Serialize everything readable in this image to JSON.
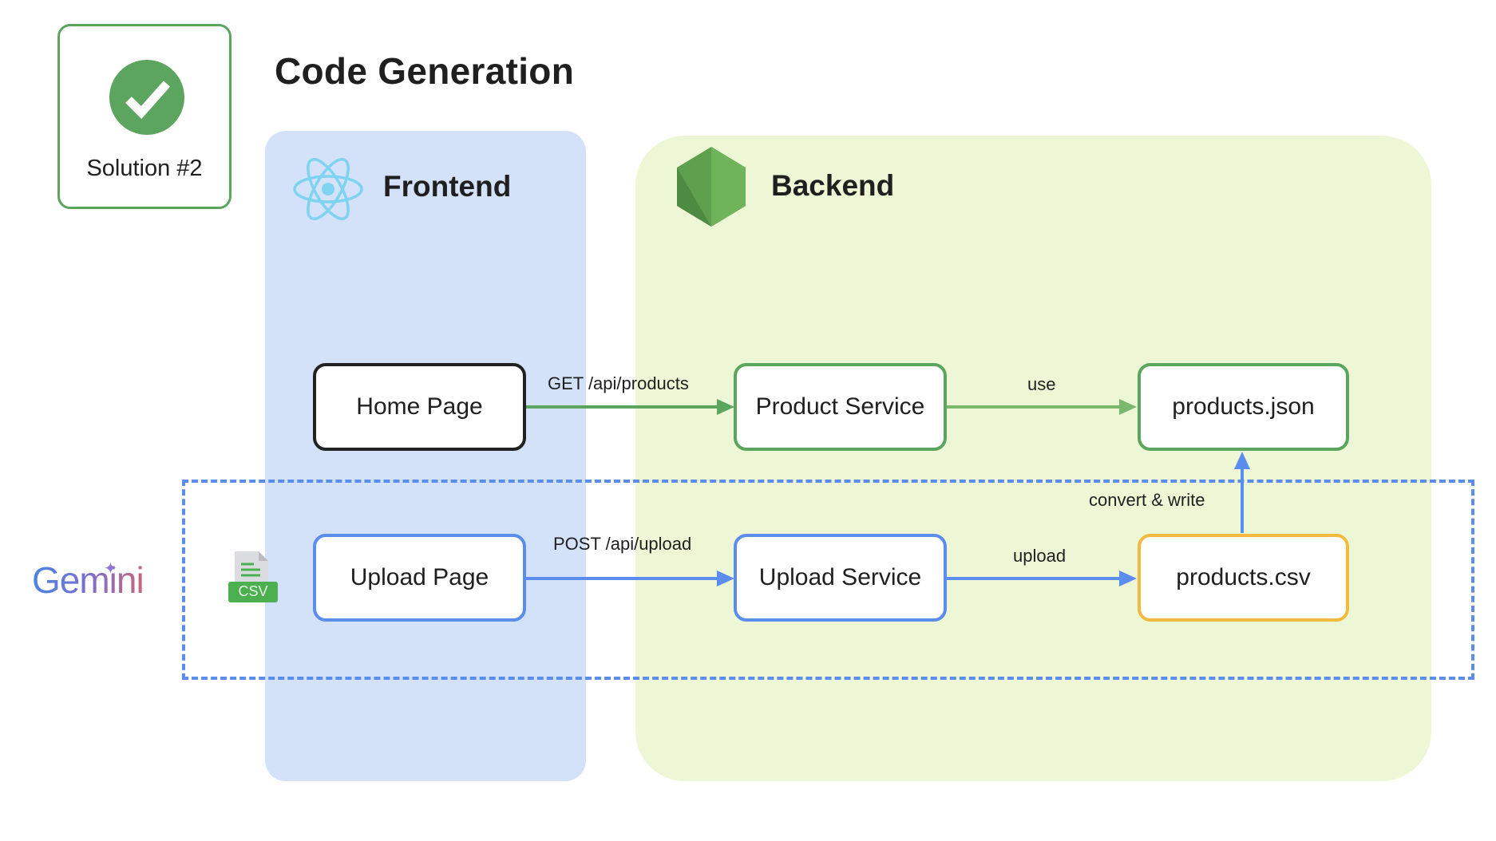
{
  "header": {
    "title": "Code Generation"
  },
  "solution": {
    "label": "Solution #2",
    "icon": "check-circle-icon",
    "color": "#5ba55e"
  },
  "frontend": {
    "title": "Frontend",
    "icon": "react-icon"
  },
  "backend": {
    "title": "Backend",
    "icon": "nodejs-icon"
  },
  "nodes": {
    "home_page": "Home Page",
    "product_service": "Product Service",
    "products_json": "products.json",
    "upload_page": "Upload Page",
    "upload_service": "Upload Service",
    "products_csv": "products.csv"
  },
  "edges": {
    "get_products": "GET /api/products",
    "use": "use",
    "post_upload": "POST /api/upload",
    "upload": "upload",
    "convert_write": "convert & write"
  },
  "gemini": {
    "label": "Gemini"
  },
  "csv_icon": {
    "label": "CSV"
  },
  "colors": {
    "green": "#5ba55e",
    "blue": "#5b8def",
    "yellow": "#f2bb3f",
    "frontend_bg": "#d3e2f8",
    "backend_bg": "#eef7d5"
  }
}
